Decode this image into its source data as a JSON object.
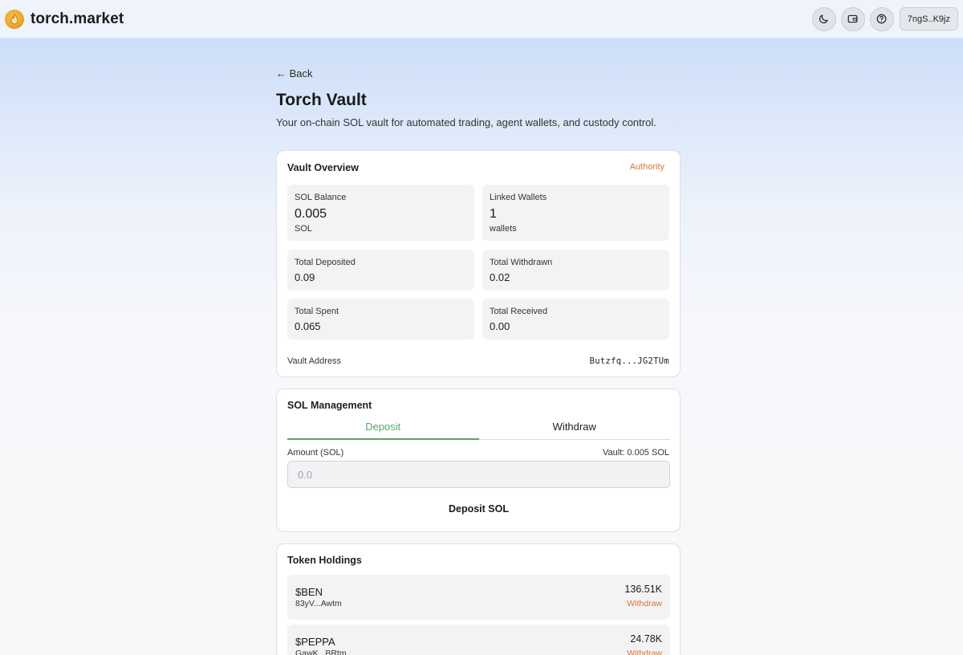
{
  "header": {
    "brand": "torch.market",
    "wallet_label": "7ngS..K9jz"
  },
  "page": {
    "back_label": "← Back",
    "title": "Torch Vault",
    "subtitle": "Your on-chain SOL vault for automated trading, agent wallets, and custody control."
  },
  "vault_overview": {
    "title": "Vault Overview",
    "role_label": "Authority",
    "sol_balance": {
      "label": "SOL Balance",
      "value": "0.005",
      "unit": "SOL"
    },
    "linked_wallets": {
      "label": "Linked Wallets",
      "value": "1",
      "unit": "wallets"
    },
    "total_deposited": {
      "label": "Total Deposited",
      "value": "0.09"
    },
    "total_withdrawn": {
      "label": "Total Withdrawn",
      "value": "0.02"
    },
    "total_spent": {
      "label": "Total Spent",
      "value": "0.065"
    },
    "total_received": {
      "label": "Total Received",
      "value": "0.00"
    },
    "address_label": "Vault Address",
    "address_value": "Butzfq...JG2TUm"
  },
  "sol_management": {
    "title": "SOL Management",
    "tabs": [
      {
        "label": "Deposit",
        "active": true
      },
      {
        "label": "Withdraw",
        "active": false
      }
    ],
    "amount_label": "Amount (SOL)",
    "vault_balance_label": "Vault: 0.005 SOL",
    "amount_placeholder": "0.0",
    "submit_label": "Deposit SOL"
  },
  "token_holdings": {
    "title": "Token Holdings",
    "items": [
      {
        "symbol": "$BEN",
        "mint": "83yV...Awtm",
        "amount": "136.51K",
        "action": "Withdraw"
      },
      {
        "symbol": "$PEPPA",
        "mint": "GawK...BRtm",
        "amount": "24.78K",
        "action": "Withdraw"
      }
    ]
  },
  "icons": {
    "brand_logo": "torch-flame-icon",
    "theme_toggle": "moon-icon",
    "wallet": "wallet-icon",
    "help": "help-circle-icon",
    "back": "arrow-left-icon"
  },
  "colors": {
    "accent_orange": "#d9743a",
    "accent_green": "#5aa56a",
    "header_bg": "#eef3fc"
  }
}
